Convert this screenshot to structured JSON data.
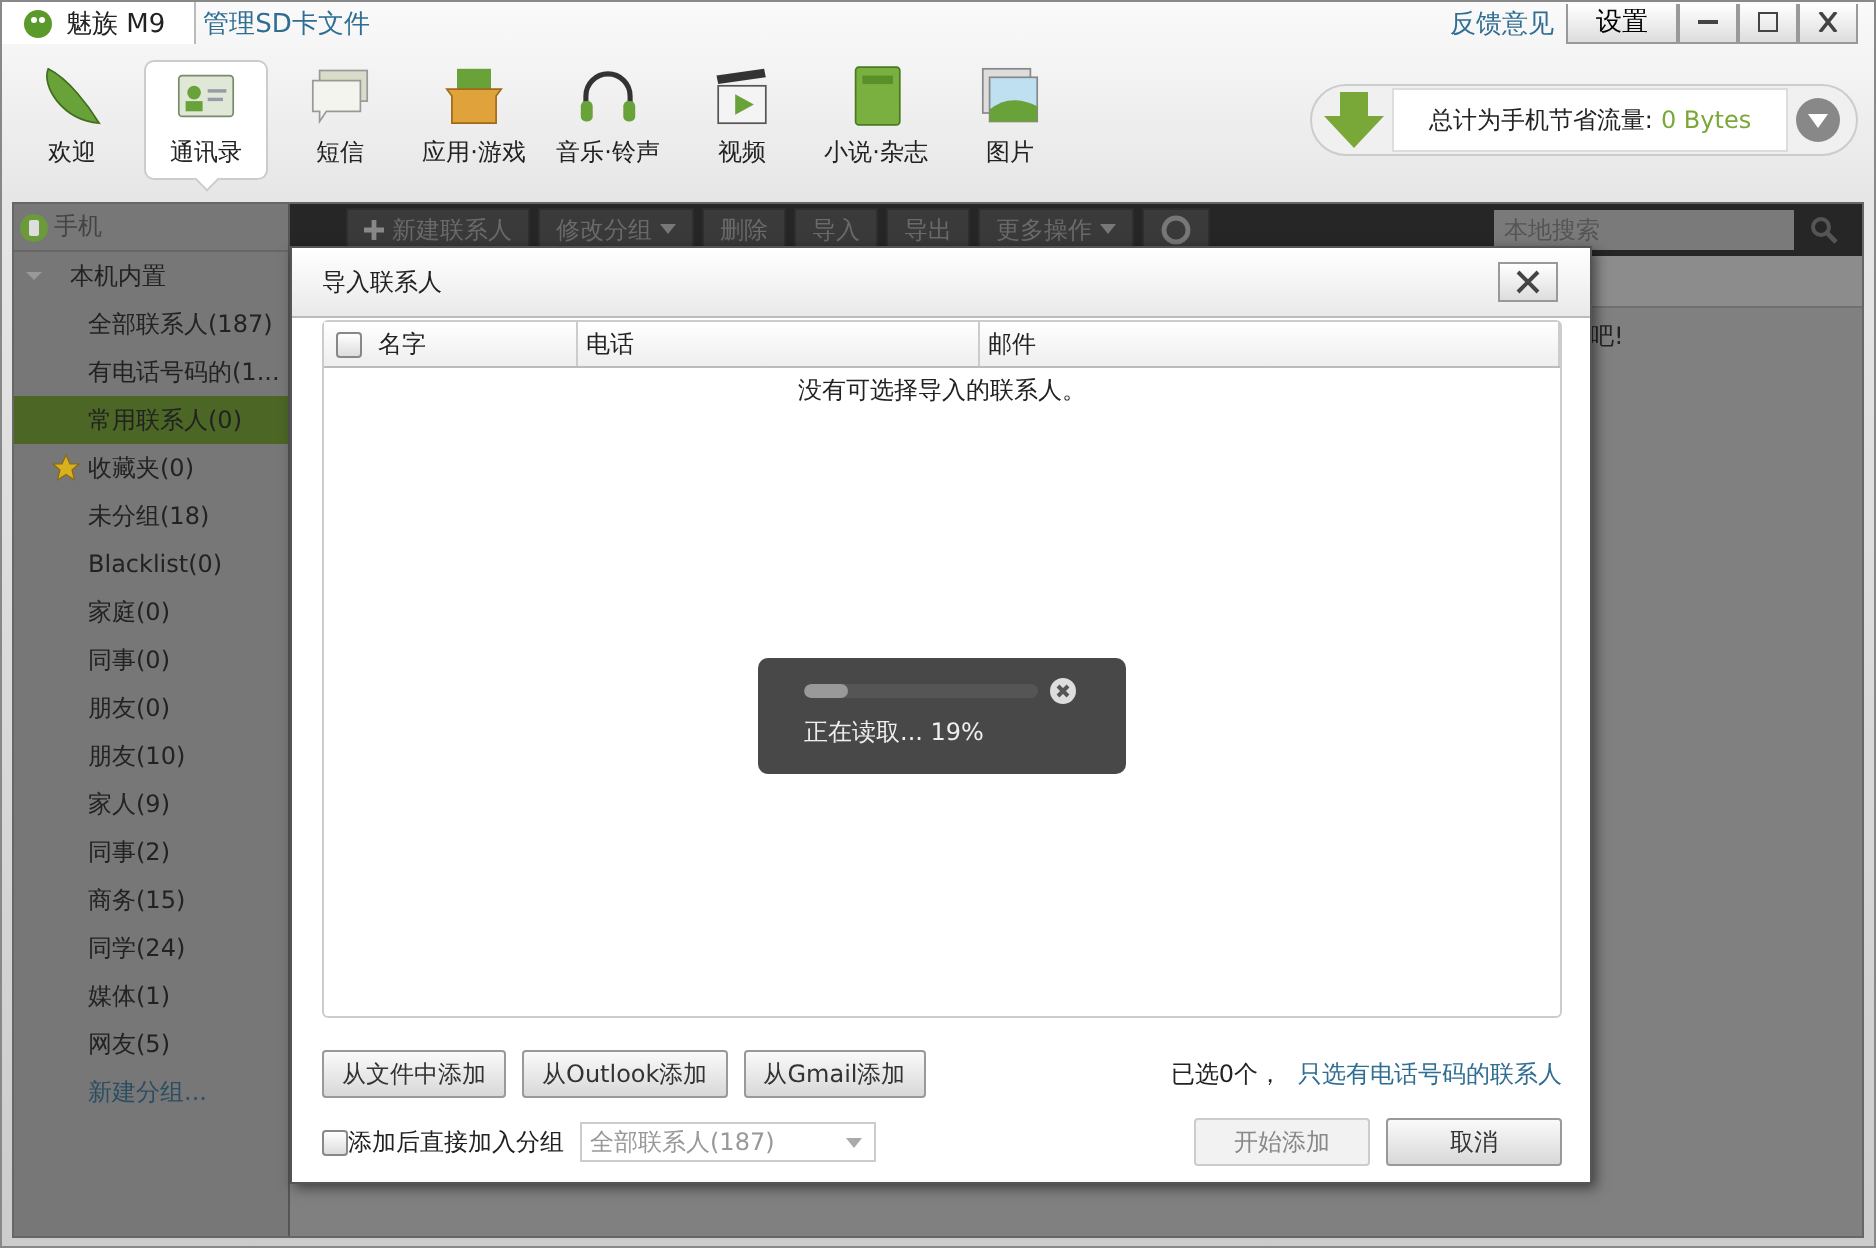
{
  "title_bar": {
    "app_name": "魅族 M9",
    "sd_link": "管理SD卡文件",
    "feedback_link": "反馈意见",
    "settings_button": "设置"
  },
  "nav": [
    {
      "label": "欢迎",
      "selected": false
    },
    {
      "label": "通讯录",
      "selected": true
    },
    {
      "label": "短信",
      "selected": false
    },
    {
      "label": "应用·游戏",
      "selected": false
    },
    {
      "label": "音乐·铃声",
      "selected": false
    },
    {
      "label": "视频",
      "selected": false
    },
    {
      "label": "小说·杂志",
      "selected": false
    },
    {
      "label": "图片",
      "selected": false
    }
  ],
  "traffic": {
    "label": "总计为手机节省流量:",
    "value": "0 Bytes"
  },
  "sidebar": {
    "header": "手机",
    "groups": [
      {
        "label": "本机内置",
        "expanded": true,
        "children": [
          {
            "label": "全部联系人(187)",
            "kind": "group",
            "selected": false
          },
          {
            "label": "有电话号码的(1...",
            "kind": "group",
            "selected": false
          },
          {
            "label": "常用联系人(0)",
            "kind": "group",
            "selected": true
          },
          {
            "label": "收藏夹(0)",
            "kind": "favorites",
            "selected": false
          },
          {
            "label": "未分组(18)",
            "kind": "group",
            "selected": false
          },
          {
            "label": "Blacklist(0)",
            "kind": "group",
            "selected": false
          },
          {
            "label": "家庭(0)",
            "kind": "group",
            "selected": false
          },
          {
            "label": "同事(0)",
            "kind": "group",
            "selected": false
          },
          {
            "label": "朋友(0)",
            "kind": "group",
            "selected": false
          },
          {
            "label": "朋友(10)",
            "kind": "group",
            "selected": false
          },
          {
            "label": "家人(9)",
            "kind": "group",
            "selected": false
          },
          {
            "label": "同事(2)",
            "kind": "group",
            "selected": false
          },
          {
            "label": "商务(15)",
            "kind": "group",
            "selected": false
          },
          {
            "label": "同学(24)",
            "kind": "group",
            "selected": false
          },
          {
            "label": "媒体(1)",
            "kind": "group",
            "selected": false
          },
          {
            "label": "网友(5)",
            "kind": "group",
            "selected": false
          },
          {
            "label": "新建分组...",
            "kind": "link",
            "selected": false
          }
        ]
      }
    ]
  },
  "toolbar": [
    {
      "label": "新建联系人",
      "kind": "add"
    },
    {
      "label": "修改分组",
      "kind": "menu"
    },
    {
      "label": "删除",
      "kind": "plain"
    },
    {
      "label": "导入",
      "kind": "plain"
    },
    {
      "label": "导出",
      "kind": "plain"
    },
    {
      "label": "更多操作",
      "kind": "menu"
    }
  ],
  "search": {
    "placeholder": "本地搜索"
  },
  "content_message": "吧!",
  "dialog": {
    "title": "导入联系人",
    "columns": [
      "名字",
      "电话",
      "邮件"
    ],
    "select_all_checked": false,
    "empty_message": "没有可选择导入的联系人。",
    "progress": {
      "level": 0.19,
      "text": "正在读取... 19%"
    },
    "source_buttons": [
      "从文件中添加",
      "从Outlook添加",
      "从Gmail添加"
    ],
    "selected_count": "已选0个，",
    "phone_only_link": "只选有电话号码的联系人",
    "add_to_group": {
      "label": "添加后直接加入分组",
      "checked": false,
      "group": "全部联系人(187)",
      "disabled": true
    },
    "buttons": [
      {
        "label": "开始添加",
        "disabled": true
      },
      {
        "label": "取消",
        "disabled": false
      }
    ]
  }
}
